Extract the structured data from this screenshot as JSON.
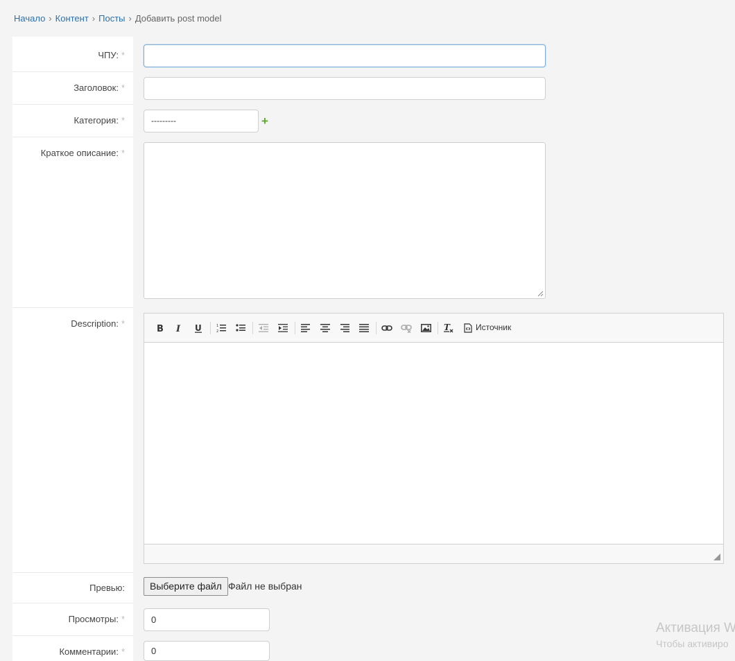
{
  "breadcrumbs": {
    "home": "Начало",
    "content": "Контент",
    "posts": "Посты",
    "current": "Добавить post model",
    "separator": "›"
  },
  "form": {
    "required_mark": "*",
    "slug": {
      "label": "ЧПУ:",
      "value": ""
    },
    "title": {
      "label": "Заголовок:",
      "value": ""
    },
    "category": {
      "label": "Категория:",
      "selected": "---------"
    },
    "short_description": {
      "label": "Краткое описание:",
      "value": ""
    },
    "description": {
      "label": "Description:"
    },
    "preview": {
      "label": "Превью:",
      "button": "Выберите файл",
      "status": "Файл не выбран"
    },
    "views": {
      "label": "Просмотры:",
      "value": "0"
    },
    "comments": {
      "label": "Комментарии:",
      "value": "0"
    }
  },
  "editor": {
    "source_label": "Источник",
    "toolbar_icons": [
      "bold-icon",
      "italic-icon",
      "underline-icon",
      "numbered-list-icon",
      "bulleted-list-icon",
      "outdent-icon",
      "indent-icon",
      "align-left-icon",
      "align-center-icon",
      "align-right-icon",
      "align-justify-icon",
      "link-icon",
      "unlink-icon",
      "image-icon",
      "remove-format-icon",
      "source-icon"
    ]
  },
  "watermark": {
    "line1": "Активация W",
    "line2": "Чтобы активиро"
  },
  "colors": {
    "link": "#2f6fa8",
    "add_icon": "#5aaa2b",
    "focus_border": "#7faed9",
    "panel_bg": "#f4f4f4"
  }
}
